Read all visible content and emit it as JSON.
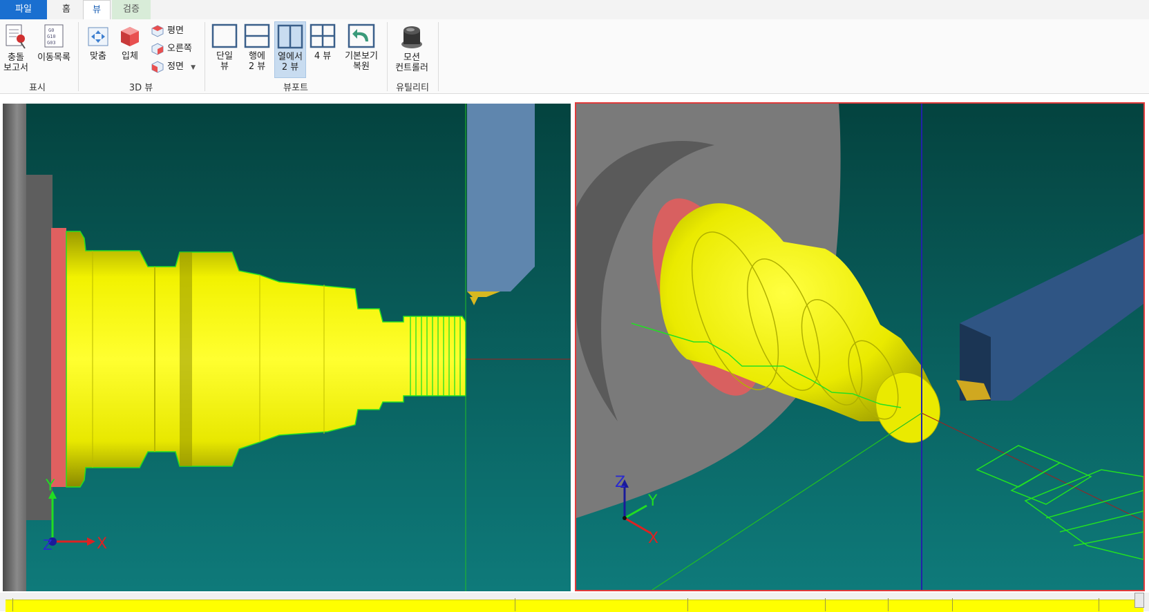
{
  "tabs": [
    {
      "label": "파일"
    },
    {
      "label": "홈"
    },
    {
      "label": "뷰"
    },
    {
      "label": "검증"
    }
  ],
  "ribbon": {
    "display": {
      "label": "표시",
      "collision_report": [
        "충돌",
        "보고서"
      ],
      "motion_list": "이동목록",
      "motion_list_icon_text": [
        "G0",
        "G10",
        "G03"
      ]
    },
    "view3d": {
      "label": "3D 뷰",
      "fit": "맞춤",
      "solid": "입체",
      "top": "평면",
      "right": "오른쪽",
      "front": "정면"
    },
    "viewport": {
      "label": "뷰포트",
      "single": [
        "단일",
        "뷰"
      ],
      "rows2": [
        "행에",
        "2 뷰"
      ],
      "cols2": [
        "열에서",
        "2 뷰"
      ],
      "four": "4 뷰",
      "restore": [
        "기본보기",
        "복원"
      ]
    },
    "utility": {
      "label": "유틸리티",
      "motion_controller": [
        "모션",
        "컨트롤러"
      ]
    }
  },
  "axes": {
    "x": "X",
    "y": "Y",
    "z": "Z"
  },
  "colors": {
    "background": "#0d6b6b",
    "part": "#ffff00",
    "toolpath": "#22e022",
    "active_border": "#e03a3a",
    "accent": "#1a6fd0"
  }
}
